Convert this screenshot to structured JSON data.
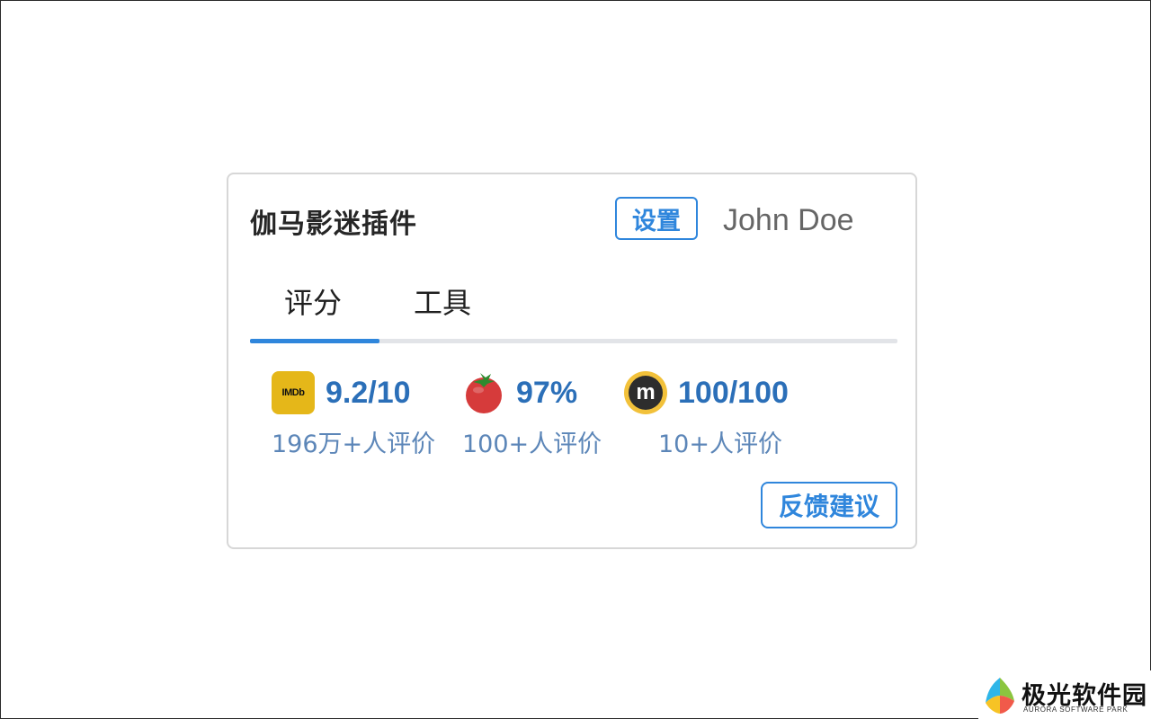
{
  "header": {
    "title": "伽马影迷插件",
    "settings_label": "设置",
    "user_name": "John Doe"
  },
  "tabs": [
    {
      "label": "评分",
      "active": true
    },
    {
      "label": "工具",
      "active": false
    }
  ],
  "ratings": [
    {
      "source": "IMDb",
      "icon": "imdb-icon",
      "logo_text": "IMDb",
      "score": "9.2/10",
      "count": "196万+人评价"
    },
    {
      "source": "Rotten Tomatoes",
      "icon": "tomato-icon",
      "score": "97%",
      "count": "100+人评价"
    },
    {
      "source": "Metacritic",
      "icon": "metacritic-icon",
      "logo_text": "m",
      "score": "100/100",
      "count": "10+人评价"
    }
  ],
  "footer": {
    "feedback_label": "反馈建议"
  },
  "watermark": {
    "title": "极光软件园",
    "subtitle": "AURORA SOFTWARE PARK"
  },
  "colors": {
    "accent": "#2f86dc",
    "score": "#2b6fb8",
    "count": "#5c86b8",
    "imdb": "#e5b719",
    "tomato": "#d63b3b",
    "metacritic": "#f2c13a"
  }
}
